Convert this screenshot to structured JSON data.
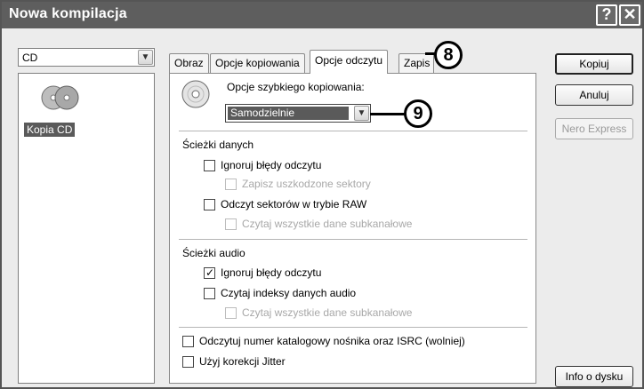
{
  "window": {
    "title": "Nowa kompilacja",
    "help_glyph": "?",
    "close_glyph": "✕"
  },
  "left": {
    "type_value": "CD",
    "item_label": "Kopia CD"
  },
  "tabs": [
    {
      "label": "Obraz"
    },
    {
      "label": "Opcje kopiowania"
    },
    {
      "label": "Opcje odczytu"
    },
    {
      "label": "Zapis"
    }
  ],
  "panel": {
    "fast_copy_label": "Opcje szybkiego kopiowania:",
    "fast_copy_value": "Samodzielnie",
    "data_tracks_heading": "Ścieżki danych",
    "data_ignore_errors": "Ignoruj błędy odczytu",
    "save_corrupted": "Zapisz uszkodzone sektory",
    "raw_read": "Odczyt sektorów w trybie RAW",
    "read_subchannel_data": "Czytaj wszystkie dane subkanałowe",
    "audio_tracks_heading": "Ścieżki audio",
    "audio_ignore_errors": "Ignoruj błędy odczytu",
    "read_audio_indexes": "Czytaj indeksy danych audio",
    "read_subchannel_audio": "Czytaj wszystkie dane subkanałowe",
    "catalog_isrc": "Odczytuj numer katalogowy nośnika oraz ISRC (wolniej)",
    "jitter": "Użyj korekcji Jitter"
  },
  "checks": {
    "data_ignore_errors": false,
    "save_corrupted": false,
    "raw_read": false,
    "read_subchannel_data": false,
    "audio_ignore_errors": true,
    "read_audio_indexes": false,
    "read_subchannel_audio": false,
    "catalog_isrc": false,
    "jitter": false
  },
  "buttons": {
    "copy": "Kopiuj",
    "cancel": "Anuluj",
    "nero_express": "Nero Express",
    "disc_info": "Info o dysku"
  },
  "callouts": {
    "tab": "8",
    "dropdown": "9"
  },
  "colors": {
    "titlebar": "#5e5e5e",
    "selection": "#5a5a5a"
  }
}
